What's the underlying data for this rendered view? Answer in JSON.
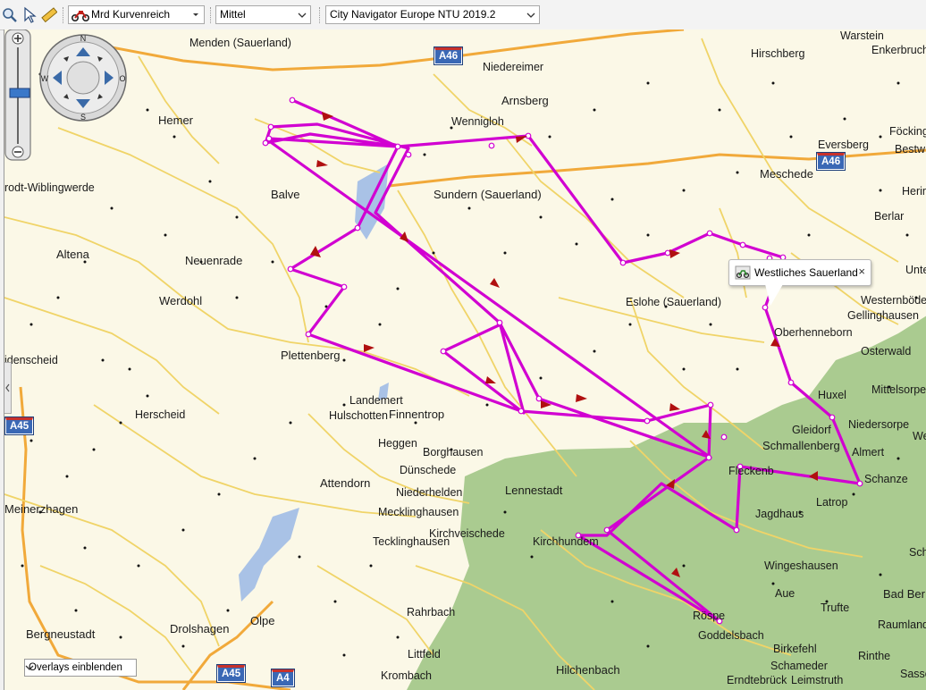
{
  "toolbar": {
    "zoom_tool_icon": "magnifier-icon",
    "select_tool_icon": "pointer-icon",
    "measure_tool_icon": "ruler-icon",
    "route_profile": "Mrd Kurvenreich",
    "route_profile_icon": "motorcycle-icon",
    "detail_level": "Mittel",
    "map_product": "City Navigator Europe NTU 2019.2"
  },
  "map": {
    "compass": {
      "n": "N",
      "s": "S",
      "w": "W",
      "o": "O"
    },
    "places": [
      {
        "id": "menden",
        "name": "Menden (Sauerland)"
      },
      {
        "id": "niedereimer",
        "name": "Niedereimer"
      },
      {
        "id": "warstein",
        "name": "Warstein"
      },
      {
        "id": "enkerbruch",
        "name": "Enkerbruch"
      },
      {
        "id": "hirschberg",
        "name": "Hirschberg"
      },
      {
        "id": "hemer",
        "name": "Hemer"
      },
      {
        "id": "arnsberg",
        "name": "Arnsberg"
      },
      {
        "id": "wennigloh",
        "name": "Wennigloh"
      },
      {
        "id": "focking",
        "name": "Föcking"
      },
      {
        "id": "eversberg",
        "name": "Eversberg"
      },
      {
        "id": "bestw",
        "name": "Bestw"
      },
      {
        "id": "meschede",
        "name": "Meschede"
      },
      {
        "id": "wiblingwerde",
        "name": "rodt-Wiblingwerde"
      },
      {
        "id": "balve",
        "name": "Balve"
      },
      {
        "id": "sundern",
        "name": "Sundern (Sauerland)"
      },
      {
        "id": "herin",
        "name": "Herin"
      },
      {
        "id": "berlar",
        "name": "Berlar"
      },
      {
        "id": "altena",
        "name": "Altena"
      },
      {
        "id": "unte",
        "name": "Unte"
      },
      {
        "id": "neuenrade",
        "name": "Neuenrade"
      },
      {
        "id": "werdohl",
        "name": "Werdohl"
      },
      {
        "id": "eslohe",
        "name": "Eslohe (Sauerland)"
      },
      {
        "id": "westernbode",
        "name": "Westernböde"
      },
      {
        "id": "gellinghausen",
        "name": "Gellinghausen"
      },
      {
        "id": "oberhenneborn",
        "name": "Oberhenneborn"
      },
      {
        "id": "ldenscheid",
        "name": "idenscheid"
      },
      {
        "id": "plettenberg",
        "name": "Plettenberg"
      },
      {
        "id": "osterwald",
        "name": "Osterwald"
      },
      {
        "id": "landemert",
        "name": "Landemert"
      },
      {
        "id": "hulschotten",
        "name": "Hulschotten"
      },
      {
        "id": "finnentrop",
        "name": "Finnentrop"
      },
      {
        "id": "huxel",
        "name": "Huxel"
      },
      {
        "id": "mittelsorpe",
        "name": "Mittelsorpe"
      },
      {
        "id": "herscheid",
        "name": "Herscheid"
      },
      {
        "id": "niedersorpe",
        "name": "Niedersorpe"
      },
      {
        "id": "gleidorf",
        "name": "Gleidorf"
      },
      {
        "id": "we",
        "name": "We"
      },
      {
        "id": "heggen",
        "name": "Heggen"
      },
      {
        "id": "borghausen",
        "name": "Borghausen"
      },
      {
        "id": "schmallenberg",
        "name": "Schmallenberg"
      },
      {
        "id": "almert",
        "name": "Almert"
      },
      {
        "id": "dunschede",
        "name": "Dünschede"
      },
      {
        "id": "fleckenberg",
        "name": "Fleckenb"
      },
      {
        "id": "schanze",
        "name": "Schanze"
      },
      {
        "id": "attendorn",
        "name": "Attendorn"
      },
      {
        "id": "lennestadt",
        "name": "Lennestadt"
      },
      {
        "id": "niederhelden",
        "name": "Niederhelden"
      },
      {
        "id": "latrop",
        "name": "Latrop"
      },
      {
        "id": "meinerzhagen",
        "name": "Meinerzhagen"
      },
      {
        "id": "mecklinghausen",
        "name": "Mecklinghausen"
      },
      {
        "id": "jagdhaus",
        "name": "Jagdhaus"
      },
      {
        "id": "kirchveischede",
        "name": "Kirchveischede"
      },
      {
        "id": "tecklinghausen",
        "name": "Tecklinghausen"
      },
      {
        "id": "kirchhundem",
        "name": "Kirchhundem"
      },
      {
        "id": "wingeshausen",
        "name": "Wingeshausen"
      },
      {
        "id": "sch",
        "name": "Sch"
      },
      {
        "id": "olpe",
        "name": "Olpe"
      },
      {
        "id": "aue",
        "name": "Aue"
      },
      {
        "id": "badberl",
        "name": "Bad Ber"
      },
      {
        "id": "bergneustadt",
        "name": "Bergneustadt"
      },
      {
        "id": "rahrbach",
        "name": "Rahrbach"
      },
      {
        "id": "truchte",
        "name": "Trufte"
      },
      {
        "id": "rospe",
        "name": "Röspe"
      },
      {
        "id": "raumland",
        "name": "Raumland"
      },
      {
        "id": "drolshagen",
        "name": "Drolshagen"
      },
      {
        "id": "goddelsbach",
        "name": "Goddelsbach"
      },
      {
        "id": "birkefehl",
        "name": "Birkefehl"
      },
      {
        "id": "rinthe",
        "name": "Rinthe"
      },
      {
        "id": "littfeld",
        "name": "Littfeld"
      },
      {
        "id": "schameder",
        "name": "Schameder"
      },
      {
        "id": "sassenh",
        "name": "Sassenh"
      },
      {
        "id": "hilchenbach",
        "name": "Hilchenbach"
      },
      {
        "id": "krombach",
        "name": "Krombach"
      },
      {
        "id": "erndtebruck",
        "name": "Erndtebrück"
      },
      {
        "id": "leimstruth",
        "name": "Leimstruth"
      }
    ],
    "shields": [
      {
        "id": "a46_top",
        "label": "A46"
      },
      {
        "id": "a46_right",
        "label": "A46"
      },
      {
        "id": "a45_left",
        "label": "A45"
      },
      {
        "id": "a45_bottom",
        "label": "A45"
      },
      {
        "id": "a4_bottom",
        "label": "A4"
      }
    ],
    "tooltip": {
      "text": "Westliches Sauerland",
      "close": "×"
    },
    "overlay_select": "Overlays einblenden",
    "colors": {
      "route": "#d500d5",
      "forest": "#a8c98f",
      "background": "#fbf8e7",
      "highway": "#f5a623",
      "road": "#f2d05a",
      "water": "#9db9e0"
    }
  }
}
